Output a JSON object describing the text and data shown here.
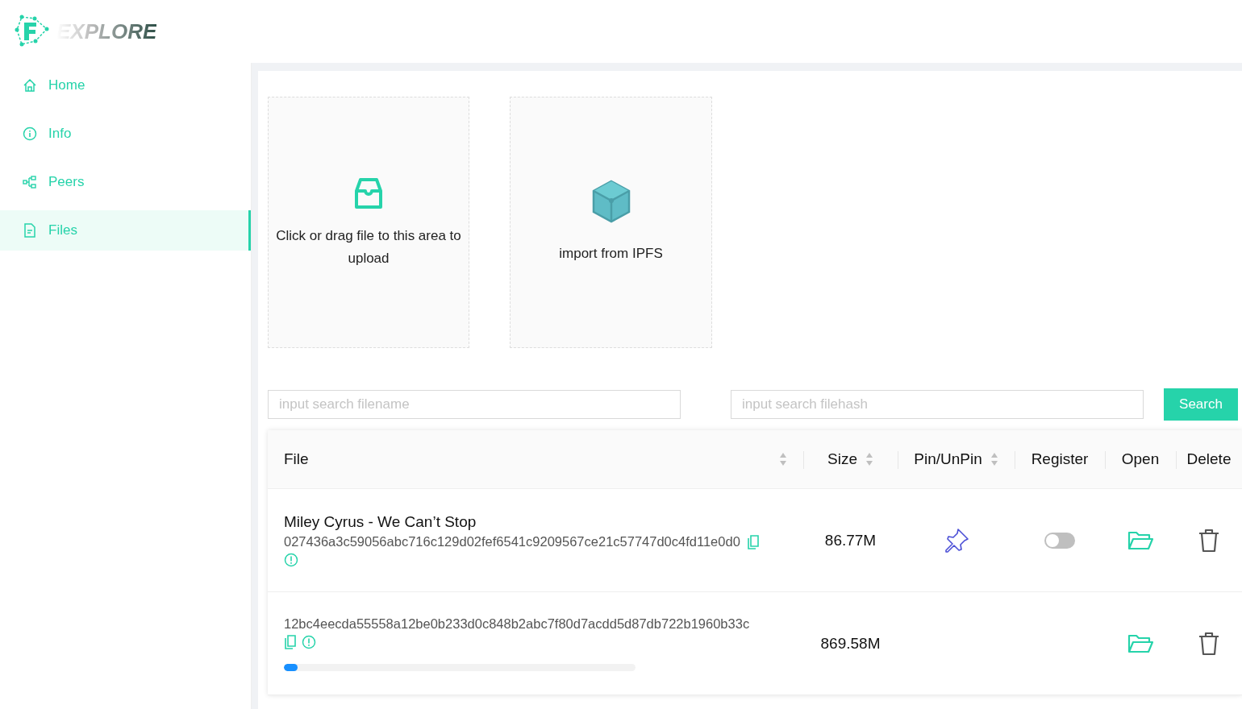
{
  "logo": {
    "text": "EXPLORE"
  },
  "nav": [
    {
      "label": "Home",
      "selected": false
    },
    {
      "label": "Info",
      "selected": false
    },
    {
      "label": "Peers",
      "selected": false
    },
    {
      "label": "Files",
      "selected": true
    }
  ],
  "upload": {
    "text": "Click or drag file to this area to upload"
  },
  "import": {
    "text": "import from IPFS"
  },
  "search": {
    "filename_placeholder": "input search filename",
    "filehash_placeholder": "input search filehash",
    "button": "Search"
  },
  "table": {
    "columns": [
      {
        "label": "File",
        "sortable": true
      },
      {
        "label": "Size",
        "sortable": true
      },
      {
        "label": "Pin/UnPin",
        "sortable": true
      },
      {
        "label": "Register",
        "sortable": false
      },
      {
        "label": "Open",
        "sortable": false
      },
      {
        "label": "Delete",
        "sortable": false
      }
    ],
    "rows": [
      {
        "name": "Miley Cyrus - We Can’t Stop",
        "hash": "027436a3c59056abc716c129d02fef6541c9209567ce21c57747d0c4fd11e0d0",
        "size": "86.77M",
        "pinnable": true,
        "registered": false
      },
      {
        "hash": "12bc4eecda55558a12be0b233d0c848b2abc7f80d7acdd5d87db722b1960b33c",
        "size": "869.58M",
        "pinnable": false,
        "level": 0.04
      }
    ]
  }
}
